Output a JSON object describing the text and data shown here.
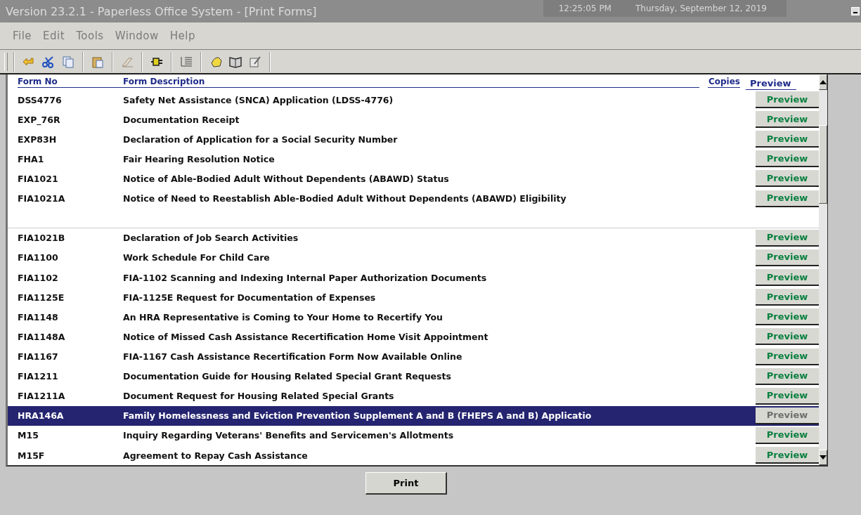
{
  "window": {
    "title": "Version 23.2.1 - Paperless Office System - [Print Forms]",
    "time": "12:25:05 PM",
    "date": "Thursday, September 12, 2019"
  },
  "menu": [
    "File",
    "Edit",
    "Tools",
    "Window",
    "Help"
  ],
  "table": {
    "columns": [
      "Form No",
      "Form Description",
      "Copies",
      "Preview"
    ],
    "rows": [
      {
        "kind": "form",
        "form_no": "DSS4776",
        "description": "Safety Net Assistance (SNCA) Application (LDSS-4776)",
        "action": "Preview",
        "selected": false
      },
      {
        "kind": "form",
        "form_no": "EXP_76R",
        "description": "Documentation Receipt",
        "action": "Preview",
        "selected": false
      },
      {
        "kind": "form",
        "form_no": "EXP83H",
        "description": "Declaration of Application for a Social Security Number",
        "action": "Preview",
        "selected": false
      },
      {
        "kind": "form",
        "form_no": "FHA1",
        "description": "Fair Hearing Resolution Notice",
        "action": "Preview",
        "selected": false
      },
      {
        "kind": "form",
        "form_no": "FIA1021",
        "description": "Notice of Able-Bodied Adult Without Dependents (ABAWD) Status",
        "action": "Preview",
        "selected": false
      },
      {
        "kind": "form",
        "form_no": "FIA1021A",
        "description": "Notice of Need to Reestablish Able-Bodied Adult Without Dependents (ABAWD) Eligibility",
        "action": "Preview",
        "selected": false
      },
      {
        "kind": "blank"
      },
      {
        "kind": "form",
        "form_no": "FIA1021B",
        "description": "Declaration of Job Search Activities",
        "action": "Preview",
        "selected": false
      },
      {
        "kind": "form",
        "form_no": "FIA1100",
        "description": "Work Schedule For Child Care",
        "action": "Preview",
        "selected": false
      },
      {
        "kind": "form",
        "form_no": "FIA1102",
        "description": "FIA-1102 Scanning and Indexing Internal Paper Authorization Documents",
        "action": "Preview",
        "selected": false
      },
      {
        "kind": "form",
        "form_no": "FIA1125E",
        "description": "FIA-1125E Request for Documentation of Expenses",
        "action": "Preview",
        "selected": false
      },
      {
        "kind": "form",
        "form_no": "FIA1148",
        "description": "An HRA Representative is Coming to Your Home to Recertify You",
        "action": "Preview",
        "selected": false
      },
      {
        "kind": "form",
        "form_no": "FIA1148A",
        "description": "Notice of Missed Cash Assistance Recertification Home Visit Appointment",
        "action": "Preview",
        "selected": false
      },
      {
        "kind": "form",
        "form_no": "FIA1167",
        "description": "FIA-1167 Cash Assistance Recertification Form Now Available Online",
        "action": "Preview",
        "selected": false
      },
      {
        "kind": "form",
        "form_no": "FIA1211",
        "description": "Documentation Guide for Housing Related Special Grant Requests",
        "action": "Preview",
        "selected": false
      },
      {
        "kind": "form",
        "form_no": "FIA1211A",
        "description": "Document Request for Housing Related Special Grants",
        "action": "Preview",
        "selected": false
      },
      {
        "kind": "form",
        "form_no": "HRA146A",
        "description": "Family Homelessness and Eviction Prevention Supplement A and B (FHEPS A and B) Applicatio",
        "action": "Preview",
        "selected": true
      },
      {
        "kind": "form",
        "form_no": "M15",
        "description": "Inquiry Regarding Veterans' Benefits and Servicemen's Allotments",
        "action": "Preview",
        "selected": false
      },
      {
        "kind": "form",
        "form_no": "M15F",
        "description": "Agreement to Repay Cash Assistance",
        "action": "Preview",
        "selected": false
      }
    ]
  },
  "print_button": "Print"
}
